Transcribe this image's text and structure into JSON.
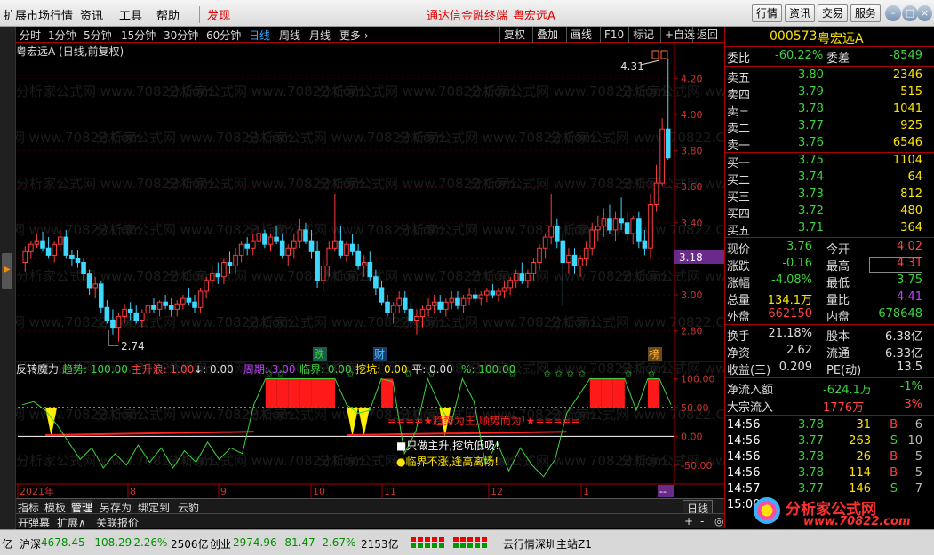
{
  "menubar": {
    "items": [
      "扩展市场行情",
      "资讯",
      "工具",
      "帮助"
    ],
    "discover": "发现",
    "title_app": "通达信金融终端",
    "title_stock": "粤宏远A",
    "right_buttons": [
      "行情",
      "资讯",
      "交易",
      "服务"
    ]
  },
  "periodbar": {
    "periods": [
      "分时",
      "1分钟",
      "5分钟",
      "15分钟",
      "30分钟",
      "60分钟",
      "日线",
      "周线",
      "月线",
      "更多 ›"
    ],
    "tools": [
      "复权",
      "叠加",
      "画线",
      "F10",
      "标记",
      "+自选",
      "返回"
    ]
  },
  "main_chart": {
    "title": "粤宏远A (日线,前复权)",
    "high_label": "4.31",
    "low_label": "2.74",
    "current_tag": "3.18",
    "markers": [
      "跌",
      "财",
      "榜"
    ],
    "watermark": "分析家公式网 www.70822.Com"
  },
  "indicator": {
    "name": "反转魔力",
    "params": [
      {
        "k": "趋势:",
        "v": "100.00",
        "c": "#3ed23e"
      },
      {
        "k": "主升浪:",
        "v": "1.00",
        "c": "#ff4545"
      },
      {
        "k": "↓:",
        "v": "0.00",
        "c": "#ddd"
      },
      {
        "k": "周期:",
        "v": "3.00",
        "c": "#c040ff"
      },
      {
        "k": "临界:",
        "v": "0.00",
        "c": "#3ed23e"
      },
      {
        "k": "挖坑:",
        "v": "0.00",
        "c": "#ffe400"
      },
      {
        "k": "平:",
        "v": "0.00",
        "c": "#ddd"
      },
      {
        "k": "%:",
        "v": "100.00",
        "c": "#3ed23e"
      }
    ],
    "banner": "====★趋势为王,顺势而为!★=====",
    "note1": "■只做主升,挖坑低吸!",
    "note2": "●临界不涨,逢高离场!"
  },
  "timeline": {
    "labels": [
      "2021年",
      "8",
      "9",
      "10",
      "11",
      "12",
      "1"
    ],
    "end": "--"
  },
  "chart_data": [
    {
      "type": "candlestick",
      "title": "粤宏远A (日线,前复权)",
      "ylim": [
        2.7,
        4.3
      ],
      "y_ticks": [
        4.2,
        4.0,
        3.8,
        3.6,
        3.4,
        3.2,
        3.0,
        2.8
      ],
      "ohlc": [
        [
          3.18,
          3.27,
          3.13,
          3.24
        ],
        [
          3.24,
          3.3,
          3.2,
          3.28
        ],
        [
          3.28,
          3.34,
          3.26,
          3.3
        ],
        [
          3.3,
          3.35,
          3.24,
          3.26
        ],
        [
          3.26,
          3.32,
          3.2,
          3.22
        ],
        [
          3.22,
          3.3,
          3.18,
          3.28
        ],
        [
          3.28,
          3.36,
          3.24,
          3.32
        ],
        [
          3.32,
          3.36,
          3.2,
          3.22
        ],
        [
          3.22,
          3.25,
          3.16,
          3.2
        ],
        [
          3.2,
          3.25,
          3.15,
          3.18
        ],
        [
          3.18,
          3.2,
          3.08,
          3.12
        ],
        [
          3.12,
          3.14,
          3.0,
          3.04
        ],
        [
          3.04,
          3.1,
          2.98,
          3.06
        ],
        [
          3.06,
          3.08,
          2.9,
          2.93
        ],
        [
          2.93,
          2.97,
          2.84,
          2.86
        ],
        [
          2.86,
          2.92,
          2.78,
          2.82
        ],
        [
          2.82,
          2.9,
          2.74,
          2.88
        ],
        [
          2.88,
          2.95,
          2.84,
          2.92
        ],
        [
          2.92,
          2.96,
          2.86,
          2.9
        ],
        [
          2.9,
          2.94,
          2.84,
          2.86
        ],
        [
          2.86,
          2.92,
          2.82,
          2.9
        ],
        [
          2.9,
          2.96,
          2.86,
          2.94
        ],
        [
          2.94,
          2.98,
          2.9,
          2.92
        ],
        [
          2.92,
          2.97,
          2.88,
          2.96
        ],
        [
          2.96,
          3.0,
          2.92,
          2.94
        ],
        [
          2.94,
          2.98,
          2.88,
          2.92
        ],
        [
          2.92,
          2.97,
          2.88,
          2.95
        ],
        [
          2.95,
          3.0,
          2.92,
          2.98
        ],
        [
          2.98,
          3.04,
          2.94,
          2.96
        ],
        [
          2.96,
          3.0,
          2.9,
          2.93
        ],
        [
          2.93,
          3.04,
          2.9,
          3.02
        ],
        [
          3.02,
          3.1,
          2.98,
          3.08
        ],
        [
          3.08,
          3.16,
          3.04,
          3.12
        ],
        [
          3.12,
          3.18,
          3.06,
          3.1
        ],
        [
          3.1,
          3.2,
          3.06,
          3.18
        ],
        [
          3.18,
          3.24,
          3.12,
          3.16
        ],
        [
          3.16,
          3.26,
          3.12,
          3.22
        ],
        [
          3.22,
          3.3,
          3.18,
          3.28
        ],
        [
          3.28,
          3.32,
          3.22,
          3.26
        ],
        [
          3.26,
          3.34,
          3.22,
          3.3
        ],
        [
          3.3,
          3.38,
          3.26,
          3.34
        ],
        [
          3.34,
          3.36,
          3.26,
          3.28
        ],
        [
          3.28,
          3.34,
          3.24,
          3.32
        ],
        [
          3.32,
          3.38,
          3.28,
          3.3
        ],
        [
          3.3,
          3.34,
          3.2,
          3.22
        ],
        [
          3.22,
          3.28,
          3.16,
          3.26
        ],
        [
          3.26,
          3.34,
          3.2,
          3.3
        ],
        [
          3.3,
          3.42,
          3.26,
          3.36
        ],
        [
          3.36,
          3.4,
          3.28,
          3.3
        ],
        [
          3.3,
          3.36,
          3.2,
          3.24
        ],
        [
          3.24,
          3.3,
          3.04,
          3.08
        ],
        [
          3.08,
          3.2,
          3.02,
          3.16
        ],
        [
          3.16,
          3.3,
          3.1,
          3.26
        ],
        [
          3.26,
          3.56,
          3.24,
          3.3
        ],
        [
          3.3,
          3.38,
          3.2,
          3.22
        ],
        [
          3.22,
          3.3,
          3.18,
          3.28
        ],
        [
          3.28,
          3.34,
          3.22,
          3.24
        ],
        [
          3.24,
          3.28,
          3.14,
          3.16
        ],
        [
          3.16,
          3.22,
          3.1,
          3.18
        ],
        [
          3.18,
          3.24,
          3.08,
          3.1
        ],
        [
          3.1,
          3.14,
          3.0,
          3.04
        ],
        [
          3.04,
          3.08,
          2.94,
          2.96
        ],
        [
          2.96,
          3.0,
          2.88,
          2.9
        ],
        [
          2.9,
          2.96,
          2.84,
          2.94
        ],
        [
          2.94,
          3.02,
          2.9,
          2.98
        ],
        [
          2.98,
          3.02,
          2.9,
          2.92
        ],
        [
          2.92,
          2.96,
          2.82,
          2.86
        ],
        [
          2.86,
          2.92,
          2.78,
          2.88
        ],
        [
          2.88,
          2.94,
          2.82,
          2.92
        ],
        [
          2.92,
          2.98,
          2.88,
          2.94
        ],
        [
          2.94,
          3.0,
          2.9,
          2.96
        ],
        [
          2.96,
          3.0,
          2.9,
          2.92
        ],
        [
          2.92,
          2.98,
          2.88,
          2.96
        ],
        [
          2.96,
          3.02,
          2.92,
          2.98
        ],
        [
          2.98,
          3.02,
          2.92,
          2.94
        ],
        [
          2.94,
          3.0,
          2.9,
          2.98
        ],
        [
          2.98,
          3.04,
          2.94,
          3.0
        ],
        [
          3.0,
          3.04,
          2.96,
          2.98
        ],
        [
          2.98,
          3.02,
          2.94,
          3.0
        ],
        [
          3.0,
          3.04,
          2.96,
          3.02
        ],
        [
          3.02,
          3.06,
          2.98,
          3.0
        ],
        [
          3.0,
          3.04,
          2.96,
          3.02
        ],
        [
          3.02,
          3.08,
          2.98,
          3.04
        ],
        [
          3.04,
          3.1,
          3.0,
          3.08
        ],
        [
          3.08,
          3.14,
          3.04,
          3.12
        ],
        [
          3.12,
          3.18,
          3.06,
          3.08
        ],
        [
          3.08,
          3.14,
          3.04,
          3.12
        ],
        [
          3.12,
          3.2,
          3.08,
          3.18
        ],
        [
          3.18,
          3.28,
          3.14,
          3.26
        ],
        [
          3.26,
          3.34,
          3.2,
          3.32
        ],
        [
          3.32,
          3.56,
          3.28,
          3.38
        ],
        [
          3.38,
          3.42,
          3.26,
          3.3
        ],
        [
          3.3,
          3.34,
          2.94,
          3.18
        ],
        [
          3.18,
          3.26,
          3.12,
          3.22
        ],
        [
          3.22,
          3.26,
          3.12,
          3.16
        ],
        [
          3.16,
          3.22,
          3.1,
          3.2
        ],
        [
          3.2,
          3.3,
          3.16,
          3.26
        ],
        [
          3.26,
          3.4,
          3.22,
          3.36
        ],
        [
          3.36,
          3.44,
          3.3,
          3.38
        ],
        [
          3.38,
          3.48,
          3.32,
          3.42
        ],
        [
          3.42,
          3.5,
          3.34,
          3.36
        ],
        [
          3.36,
          3.46,
          3.3,
          3.42
        ],
        [
          3.42,
          3.54,
          3.36,
          3.4
        ],
        [
          3.4,
          3.46,
          3.3,
          3.34
        ],
        [
          3.34,
          3.44,
          3.28,
          3.42
        ],
        [
          3.42,
          3.46,
          3.26,
          3.3
        ],
        [
          3.3,
          3.36,
          3.22,
          3.26
        ],
        [
          3.26,
          3.56,
          3.2,
          3.5
        ],
        [
          3.5,
          3.72,
          3.46,
          3.62
        ],
        [
          3.62,
          3.98,
          3.6,
          3.92
        ],
        [
          3.92,
          4.31,
          3.75,
          3.76
        ]
      ]
    },
    {
      "type": "line",
      "title": "反转魔力",
      "ylim": [
        -75,
        110
      ],
      "y_ticks": [
        100,
        50,
        0,
        -50
      ],
      "x": [
        0,
        2,
        4,
        6,
        8,
        10,
        12,
        14,
        16,
        18,
        20,
        22,
        24,
        26,
        28,
        30,
        32,
        34,
        36,
        38,
        40,
        42,
        44,
        46,
        48,
        50,
        52,
        54,
        56,
        58,
        60,
        62,
        64,
        66,
        68,
        70,
        72,
        74,
        76,
        78,
        80,
        82,
        84,
        86,
        88,
        90,
        92,
        94,
        96,
        98,
        100,
        102,
        104,
        106,
        108,
        110,
        112
      ],
      "values": [
        55,
        60,
        45,
        20,
        -10,
        -40,
        -20,
        -55,
        -30,
        -50,
        -15,
        -45,
        -20,
        -55,
        -25,
        -45,
        -10,
        -40,
        -20,
        -30,
        55,
        100,
        100,
        100,
        100,
        100,
        100,
        100,
        55,
        40,
        45,
        100,
        95,
        -30,
        10,
        100,
        55,
        20,
        100,
        60,
        -50,
        -10,
        -60,
        -20,
        -50,
        -70,
        -40,
        40,
        70,
        100,
        100,
        100,
        100,
        45,
        100,
        100,
        55
      ],
      "band_0": 50,
      "band_1": 0
    }
  ],
  "quote": {
    "code": "000573",
    "name": "粤宏远A",
    "wei_bi_label": "委比",
    "wei_bi": "-60.22%",
    "wei_cha_label": "委差",
    "wei_cha": "-8549",
    "sell": [
      {
        "l": "卖五",
        "p": "3.80",
        "v": "2346"
      },
      {
        "l": "卖四",
        "p": "3.79",
        "v": "515"
      },
      {
        "l": "卖三",
        "p": "3.78",
        "v": "1041"
      },
      {
        "l": "卖二",
        "p": "3.77",
        "v": "925"
      },
      {
        "l": "卖一",
        "p": "3.76",
        "v": "6546"
      }
    ],
    "buy": [
      {
        "l": "买一",
        "p": "3.75",
        "v": "1104"
      },
      {
        "l": "买二",
        "p": "3.74",
        "v": "64"
      },
      {
        "l": "买三",
        "p": "3.73",
        "v": "812"
      },
      {
        "l": "买四",
        "p": "3.72",
        "v": "480"
      },
      {
        "l": "买五",
        "p": "3.71",
        "v": "364"
      }
    ],
    "stats": [
      [
        "现价",
        "3.76",
        "今开",
        "4.02"
      ],
      [
        "涨跌",
        "-0.16",
        "最高",
        "4.31"
      ],
      [
        "涨幅",
        "-4.08%",
        "最低",
        "3.75"
      ],
      [
        "总量",
        "134.1万",
        "量比",
        "4.41"
      ],
      [
        "外盘",
        "662150",
        "内盘",
        "678648"
      ]
    ],
    "stats2": [
      [
        "换手",
        "21.18%",
        "股本",
        "6.38亿"
      ],
      [
        "净资",
        "2.62",
        "流通",
        "6.33亿"
      ],
      [
        "收益(三)",
        "0.209",
        "PE(动)",
        "13.5"
      ]
    ],
    "flow": [
      [
        "净流入额",
        "-624.1万",
        "-1%"
      ],
      [
        "大宗流入",
        "1776万",
        "3%"
      ]
    ],
    "ticks": [
      [
        "14:56",
        "3.78",
        "31",
        "B",
        "6"
      ],
      [
        "14:56",
        "3.77",
        "263",
        "S",
        "10"
      ],
      [
        "14:56",
        "3.78",
        "26",
        "B",
        "5"
      ],
      [
        "14:56",
        "3.78",
        "114",
        "B",
        "5"
      ],
      [
        "14:57",
        "3.77",
        "146",
        "S",
        "7"
      ],
      [
        "15:00",
        "",
        "",
        "",
        ""
      ]
    ]
  },
  "bottom": {
    "tabs": [
      "指标",
      "模板",
      "管理",
      "另存为",
      "绑定到",
      "云豹"
    ],
    "tabs2": [
      "开弹幕",
      "扩展∧",
      "关联报价"
    ],
    "period": "日线"
  },
  "status": {
    "yi": "亿",
    "sh_label": "沪深",
    "sh_val": "4678.45",
    "sh_chg": "-108.29",
    "sh_pct": "-2.26%",
    "sh_amt": "2506亿",
    "cy_label": "创业",
    "cy_val": "2974.96",
    "cy_chg": "-81.47",
    "cy_pct": "-2.67%",
    "cy_amt": "2153亿",
    "server": "云行情深圳主站Z1"
  },
  "logo": {
    "text": "分析家公式网",
    "url": "www.70822.com"
  }
}
